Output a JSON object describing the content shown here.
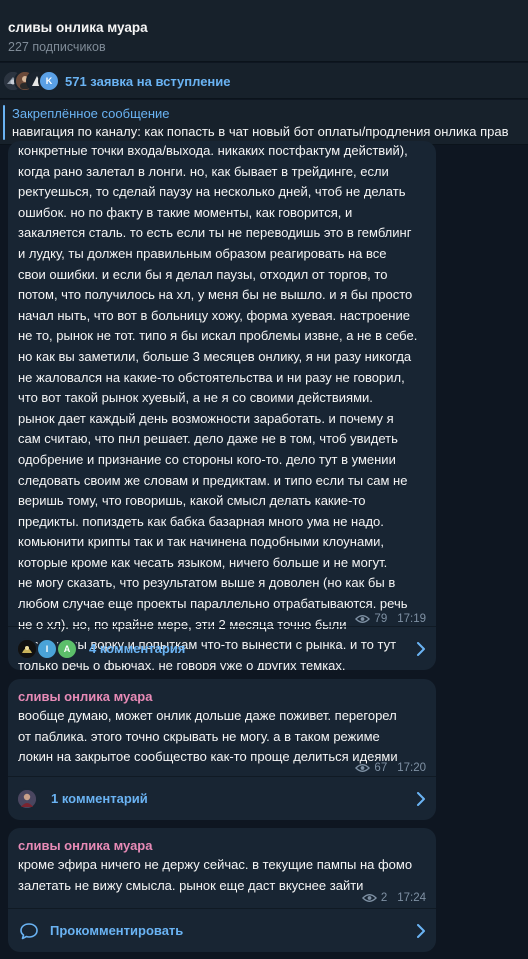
{
  "header": {
    "title": "сливы онлика муара",
    "subscribers": "227 подписчиков"
  },
  "join_requests": {
    "label": "571 заявка на вступление",
    "avatar_letter": "K"
  },
  "pinned": {
    "title": "Закреплённое сообщение",
    "text": "навигация по каналу:  как попасть в чат новый бот оплаты/продления онлика прав"
  },
  "posts": [
    {
      "text": "конкретные точки входа/выхода. никаких постфактум действий),\nкогда рано залетал в лонги. но, как бывает в трейдинге, если\nректуешься, то сделай паузу на несколько дней, чтоб не делать\nошибок. но по факту в такие моменты, как говорится, и\nзакаляется сталь. то есть если ты не переводишь это в гемблинг\nи лудку, ты должен правильным образом реагировать на все\nсвои ошибки. и если бы я делал паузы, отходил от торгов, то\nпотом, что получилось на хл, у меня бы не вышло. и я бы просто\nначал ныть, что вот в больницу хожу, форма хуевая. настроение\nне то, рынок не тот. типо я бы искал проблемы извне, а не в себе.\nно как вы заметили, больше 3 месяцев онлику, я ни разу никогда\nне жаловался на какие-то обстоятельства и ни разу не говорил,\nчто вот такой рынок хуевый, а не я со своими действиями.\nрынок дает каждый день возможности заработать. и почему я\nсам считаю, что пнл решает. дело даже не в том, чтоб увидеть\nодобрение и признание со стороны кого-то. дело тут в умении\nследовать своим же словам и предиктам. и типо если ты сам не\nверишь тому, что говоришь, какой смысл делать какие-то\nпредикты. попиздеть как бабка базарная много ума не надо.\nкомьюнити крипты так и так начинена подобными клоунами,\nкоторые кроме как чесать языком, ничего больше и не могут.\nне могу сказать, что результатом выше я доволен (но как бы в\nлюбом случае еще проекты параллельно отрабатываются. речь\nне о хл). но, по крайне мере, эти 2 месяца точно были\nпосвящены ворку и попыткам что-то вынести с рынка. и то тут\nтолько речь о фьючах, не говоря уже о других темках.",
      "views": "79",
      "time": "17:19",
      "comments_label": "4 комментария",
      "commenter_letters": [
        "I",
        "A"
      ]
    },
    {
      "sender": "сливы онлика муара",
      "text": "вообще думаю, может онлик дольше даже поживет. перегорел\nот паблика. этого точно скрывать не могу. а в таком режиме\nлокин на закрытое сообщество как-то проще делиться идеями",
      "views": "67",
      "time": "17:20",
      "comments_label": "1 комментарий"
    },
    {
      "sender": "сливы онлика муара",
      "text": "кроме эфира ничего не держу сейчас. в текущие пампы на фомо\nзалетать не вижу смысла. рынок еще даст вкуснее зайти",
      "views": "2",
      "time": "17:24",
      "comments_label": "Прокомментировать"
    }
  ],
  "colors": {
    "background": "#0e1621",
    "panel": "#17212b",
    "bubble": "#182533",
    "accent": "#6ab3f3",
    "sender": "#e88bb7",
    "meta": "#7f91a4"
  }
}
